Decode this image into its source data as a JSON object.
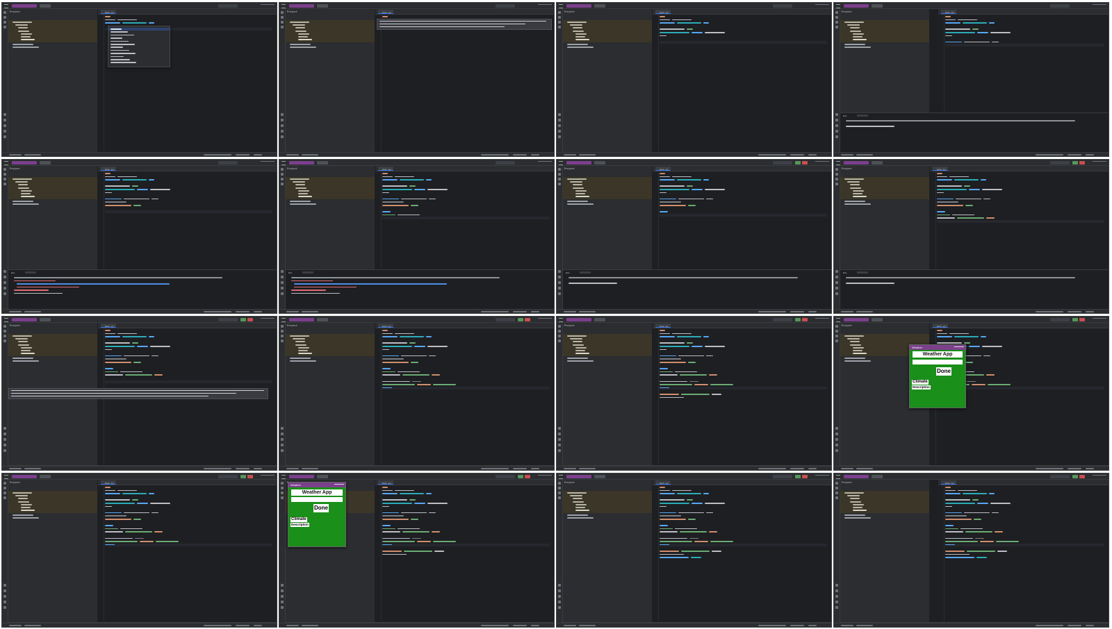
{
  "ide": {
    "project_panel_title": "Project",
    "editor_file_tab": "main.py",
    "run_panel_tab": "Run"
  },
  "weather_app": {
    "window_title": "Weather",
    "heading": "Weather App",
    "button_label": "Done",
    "climate_label": "Climate",
    "description_label": "Description"
  },
  "colors": {
    "ide_background": "#1e1f22",
    "panel_background": "#2b2d30",
    "tree_highlight": "#3b3627",
    "app_window_green": "#1a8f1a",
    "accent_purple": "#7b3f8c"
  }
}
